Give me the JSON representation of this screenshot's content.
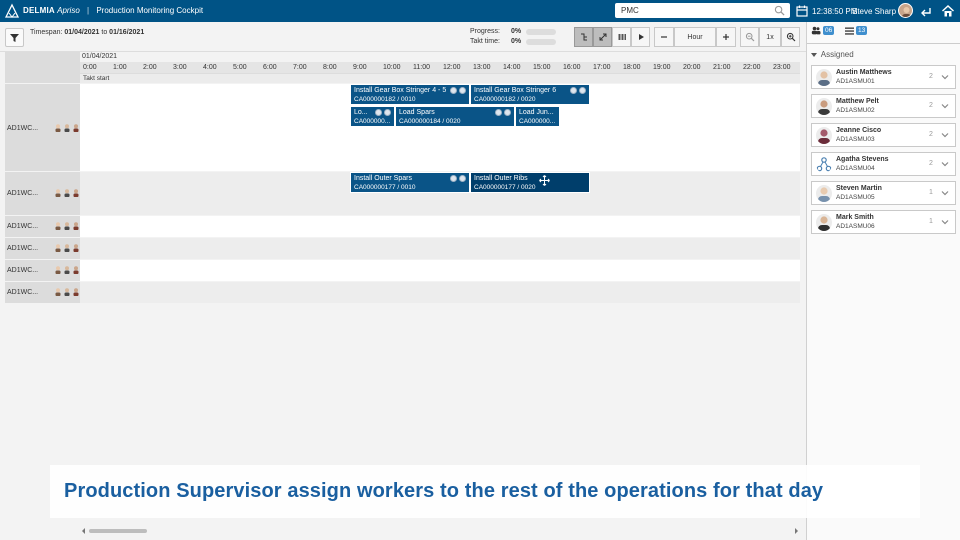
{
  "header": {
    "brand_name": "DELMIA",
    "brand_product": "Apriso",
    "app_title": "Production Monitoring Cockpit",
    "search_value": "PMC",
    "clock": "12:38:50 PM",
    "user_name": "Steve Sharp"
  },
  "toolbar": {
    "timespan_label": "Timespan:",
    "timespan_from": "01/04/2021",
    "timespan_to_word": "to",
    "timespan_to": "01/16/2021",
    "progress_label": "Progress:",
    "progress_value": "0%",
    "takt_label": "Takt time:",
    "takt_value": "0%",
    "zoom_unit": "Hour",
    "zoom_factor": "1x",
    "progress_fraction": 0,
    "takt_fraction": 0
  },
  "gantt": {
    "date": "01/04/2021",
    "takt_start": "Takt start",
    "hours": [
      "0:00",
      "1:00",
      "2:00",
      "3:00",
      "4:00",
      "5:00",
      "6:00",
      "7:00",
      "8:00",
      "9:00",
      "10:00",
      "11:00",
      "12:00",
      "13:00",
      "14:00",
      "15:00",
      "16:00",
      "17:00",
      "18:00",
      "19:00",
      "20:00",
      "21:00",
      "22:00",
      "23:00"
    ],
    "rows": [
      {
        "label": "AD1WC..."
      },
      {
        "label": "AD1WC..."
      },
      {
        "label": "AD1WC..."
      },
      {
        "label": "AD1WC..."
      },
      {
        "label": "AD1WC..."
      },
      {
        "label": "AD1WC..."
      }
    ],
    "tasks": [
      {
        "name": "Install Gear Box Stringer 4 - 5",
        "code": "CA000000182 / 0010"
      },
      {
        "name": "Install Gear Box Stringer 6",
        "code": "CA000000182 / 0020"
      },
      {
        "name": "Lo...",
        "code": "CA000000..."
      },
      {
        "name": "Load Spars",
        "code": "CA000000184 / 0020"
      },
      {
        "name": "Load Jun...",
        "code": "CA000000..."
      },
      {
        "name": "Install Outer Spars",
        "code": "CA000000177 / 0010"
      },
      {
        "name": "Install Outer Ribs",
        "code": "CA000000177 / 0020"
      }
    ]
  },
  "right_panel": {
    "tab_people_count": "06",
    "tab_list_count": "13",
    "section_title": "Assigned",
    "workers": [
      {
        "name": "Austin Matthews",
        "id": "AD1ASMU01",
        "count": "2"
      },
      {
        "name": "Matthew Pelt",
        "id": "AD1ASMU02",
        "count": "2"
      },
      {
        "name": "Jeanne Cisco",
        "id": "AD1ASMU03",
        "count": "2"
      },
      {
        "name": "Agatha Stevens",
        "id": "AD1ASMU04",
        "count": "2"
      },
      {
        "name": "Steven Martin",
        "id": "AD1ASMU05",
        "count": "1"
      },
      {
        "name": "Mark Smith",
        "id": "AD1ASMU06",
        "count": "1"
      }
    ]
  },
  "caption": "Production Supervisor assign workers to the rest of the operations for that day",
  "colors": {
    "topbar": "#005386",
    "task": "#0a5487",
    "caption_text": "#1a5fa0"
  }
}
